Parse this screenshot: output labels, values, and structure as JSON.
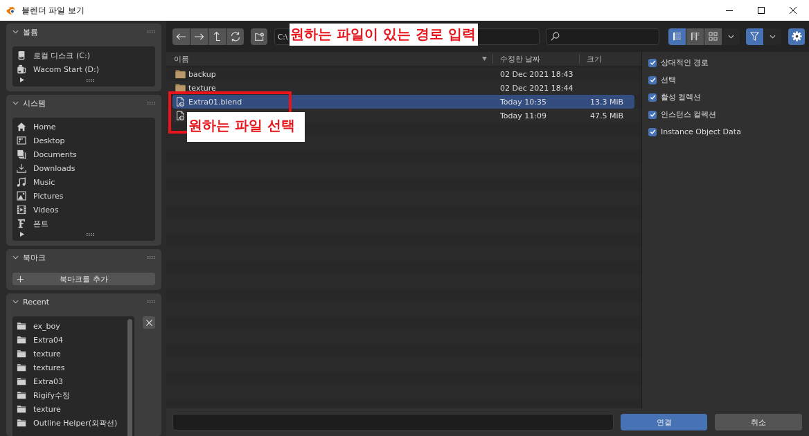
{
  "window": {
    "title": "블렌더 파일 보기"
  },
  "sidebar": {
    "panels": [
      {
        "kind": "list",
        "title": "볼륨",
        "expanded": true,
        "items": [
          {
            "kind": "disk",
            "label": "로컬 디스크 (C:)"
          },
          {
            "kind": "drive",
            "label": "Wacom Start (D:)"
          }
        ]
      },
      {
        "kind": "list",
        "title": "시스템",
        "expanded": true,
        "items": [
          {
            "kind": "home",
            "label": "Home"
          },
          {
            "kind": "desktop",
            "label": "Desktop"
          },
          {
            "kind": "documents",
            "label": "Documents"
          },
          {
            "kind": "downloads",
            "label": "Downloads"
          },
          {
            "kind": "music",
            "label": "Music"
          },
          {
            "kind": "pictures",
            "label": "Pictures"
          },
          {
            "kind": "videos",
            "label": "Videos"
          },
          {
            "kind": "fonts",
            "label": "폰트"
          }
        ]
      },
      {
        "kind": "action",
        "title": "북마크",
        "expanded": true,
        "button": "북마크를 추가"
      },
      {
        "kind": "recent",
        "title": "Recent",
        "expanded": true,
        "items": [
          {
            "kind": "folder",
            "label": "ex_boy"
          },
          {
            "kind": "folder",
            "label": "Extra04"
          },
          {
            "kind": "folder",
            "label": "texture"
          },
          {
            "kind": "folder",
            "label": "textures"
          },
          {
            "kind": "folder",
            "label": "Extra03"
          },
          {
            "kind": "folder",
            "label": "Rigify수정"
          },
          {
            "kind": "folder",
            "label": "texture"
          },
          {
            "kind": "folder",
            "label": "Outline Helper(외곽선)"
          }
        ]
      }
    ]
  },
  "toolbar": {
    "path": "C:\\",
    "display_modes": [
      {
        "kind": "vertical",
        "selected": true
      },
      {
        "kind": "horizontal",
        "selected": false
      },
      {
        "kind": "thumbnails",
        "selected": false
      }
    ],
    "filter": {
      "on": true
    },
    "settings": {
      "on": true
    }
  },
  "file_list": {
    "columns": [
      {
        "label": "이름",
        "sorted": true
      },
      {
        "label": "수정한 날짜",
        "sorted": false
      },
      {
        "label": "크기",
        "sorted": false
      }
    ],
    "rows": [
      {
        "kind": "folder",
        "name": "backup",
        "date": "02 Dec 2021 18:43",
        "selected": false
      },
      {
        "kind": "folder",
        "name": "texture",
        "date": "02 Dec 2021 18:44",
        "selected": false
      },
      {
        "kind": "blend",
        "name": "Extra01.blend",
        "date": "Today 10:35",
        "size": "13.3 MiB",
        "selected": true
      },
      {
        "kind": "blend",
        "date": "Today 11:09",
        "size": "47.5 MiB",
        "selected": false
      }
    ]
  },
  "options": [
    {
      "label": "상대적인 경로",
      "checked": true
    },
    {
      "label": "선택",
      "checked": true
    },
    {
      "label": "활성 컬렉션",
      "checked": true
    },
    {
      "label": "인스턴스 컬렉션",
      "checked": true
    },
    {
      "label": "Instance Object Data",
      "checked": true
    }
  ],
  "bottom_bar": {
    "buttons": [
      {
        "kind": "primary",
        "label": "연결"
      },
      {
        "kind": "secondary",
        "label": "취소"
      }
    ]
  },
  "annotations": [
    {
      "kind": "note",
      "text": "원하는 파일이 있는 경로 입력"
    },
    {
      "kind": "frame"
    },
    {
      "kind": "note",
      "text": "원하는 파일 선택"
    }
  ]
}
